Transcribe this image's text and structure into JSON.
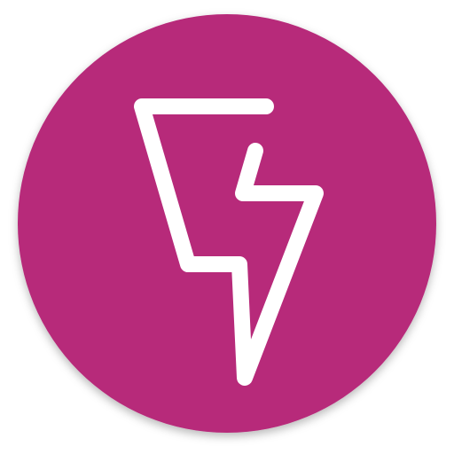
{
  "icon": {
    "name": "lightning-bolt-icon",
    "background_color": "#B72A7A",
    "foreground_color": "#FFFFFF"
  }
}
